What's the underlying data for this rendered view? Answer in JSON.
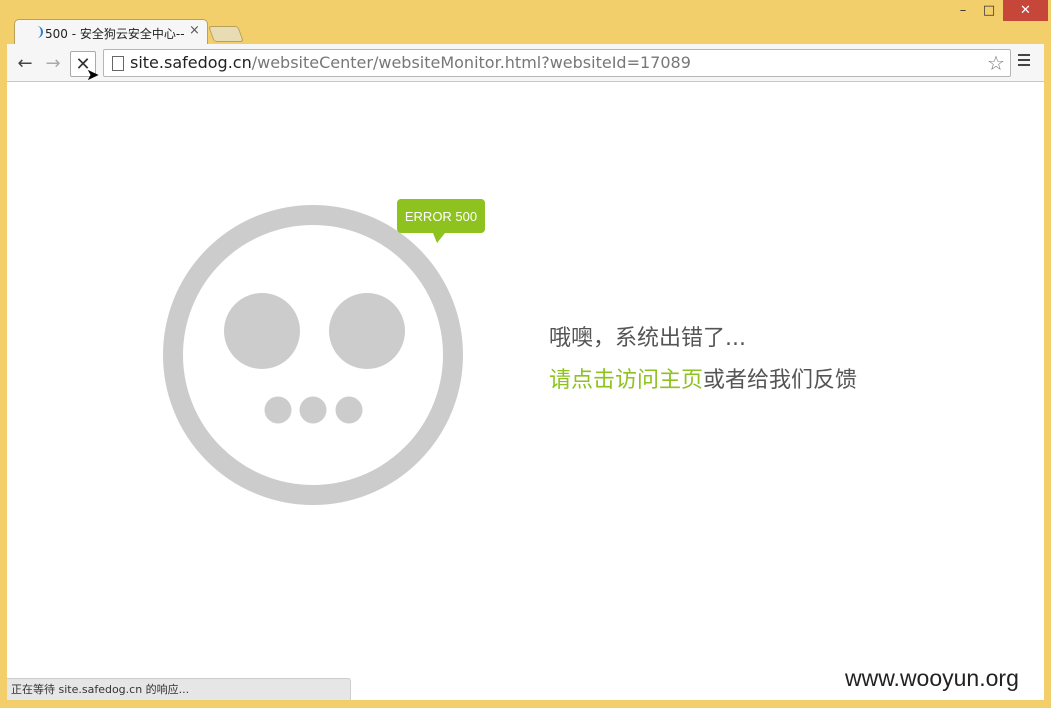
{
  "window": {
    "tab_title": "500 - 安全狗云安全中心--",
    "tab_close": "×",
    "controls": {
      "minimize": "–",
      "maximize": "□",
      "close": "✕"
    }
  },
  "toolbar": {
    "back": "←",
    "forward": "→",
    "stop": "✕",
    "url_host": "site.safedog.cn",
    "url_rest": "/websiteCenter/websiteMonitor.html?websiteId=17089",
    "star": "☆"
  },
  "page": {
    "badge": "ERROR 500",
    "line1": "哦噢，系统出错了...",
    "link_text": "请点击访问主页",
    "line2_rest": "或者给我们反馈",
    "face_color": "#cccccc",
    "accent_color": "#8dc21f"
  },
  "status_text": "正在等待 site.safedog.cn 的响应...",
  "watermark": "www.wooyun.org"
}
